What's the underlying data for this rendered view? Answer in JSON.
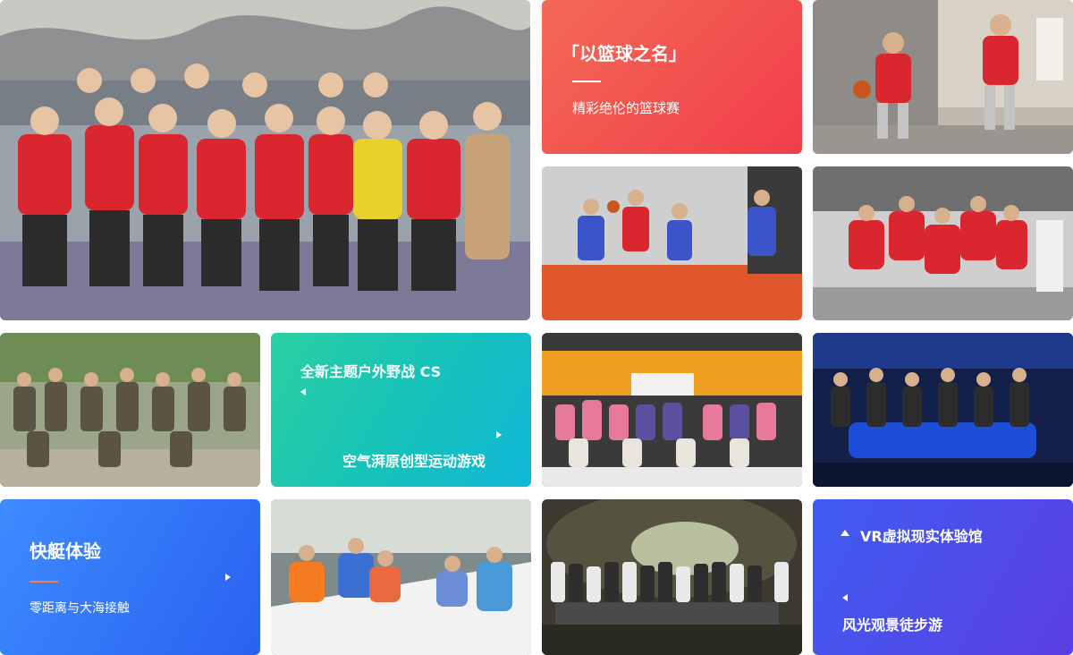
{
  "basketball": {
    "title": "「以篮球之名」",
    "subtitle": "精彩绝伦的篮球赛"
  },
  "cs": {
    "title": "全新主题户外野战 CS",
    "subtitle": "空气湃原创型运动游戏"
  },
  "boat": {
    "title": "快艇体验",
    "subtitle": "零距离与大海接触"
  },
  "vr": {
    "title": "VR虚拟现实体验馆",
    "subtitle": "风光观景徒步游"
  },
  "photos": [
    {
      "id": "team-basketball-group-photo",
      "label": "basketball team group photo with trophies"
    },
    {
      "id": "basketball-dribble-photo",
      "label": "players in red jerseys dribbling"
    },
    {
      "id": "basketball-indoor-game-photo",
      "label": "indoor basketball game"
    },
    {
      "id": "basketball-huddle-photo",
      "label": "team huddle in red jerseys"
    },
    {
      "id": "outdoor-cs-group-photo",
      "label": "outdoor paintball team photo"
    },
    {
      "id": "indoor-event-group-photo",
      "label": "indoor event group photo"
    },
    {
      "id": "vr-hall-group-photo",
      "label": "VR experience hall group photo"
    },
    {
      "id": "sailing-boat-photo",
      "label": "people on sailing boat"
    },
    {
      "id": "cave-hiking-group-photo",
      "label": "group photo in cave"
    }
  ],
  "colors": {
    "red_card": "#f2464f",
    "teal_card": "#16c3b8",
    "blue_card": "#2e6cf6",
    "indigo_card": "#4b4be8",
    "accent_line": "#ff7a45"
  }
}
